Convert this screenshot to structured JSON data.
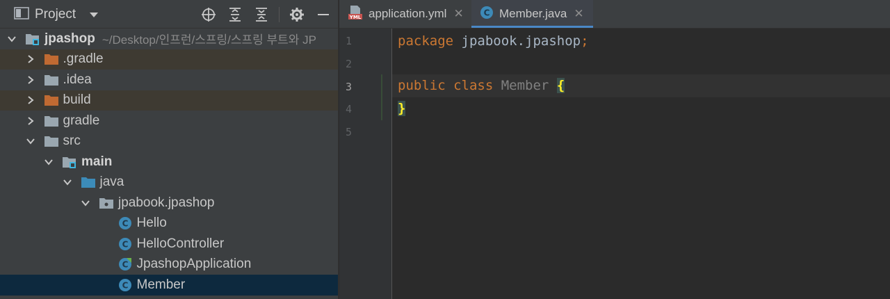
{
  "project_panel": {
    "title": "Project",
    "tree": [
      {
        "label": "jpashop",
        "path": "~/Desktop/인프런/스프링/스프링 부트와 JP",
        "depth": 0,
        "expanded": true,
        "icon": "module-folder-icon",
        "bold": true,
        "row": "normal"
      },
      {
        "label": ".gradle",
        "depth": 1,
        "expanded": false,
        "icon": "excluded-folder-icon",
        "row": "ignored"
      },
      {
        "label": ".idea",
        "depth": 1,
        "expanded": false,
        "icon": "folder-icon",
        "row": "normal"
      },
      {
        "label": "build",
        "depth": 1,
        "expanded": false,
        "icon": "excluded-folder-icon",
        "row": "ignored"
      },
      {
        "label": "gradle",
        "depth": 1,
        "expanded": false,
        "icon": "folder-icon",
        "row": "normal"
      },
      {
        "label": "src",
        "depth": 1,
        "expanded": true,
        "icon": "folder-icon",
        "row": "normal"
      },
      {
        "label": "main",
        "depth": 2,
        "expanded": true,
        "icon": "module-folder-icon",
        "bold": true,
        "row": "normal"
      },
      {
        "label": "java",
        "depth": 3,
        "expanded": true,
        "icon": "source-folder-icon",
        "row": "normal"
      },
      {
        "label": "jpabook.jpashop",
        "depth": 4,
        "expanded": true,
        "icon": "package-icon",
        "row": "normal"
      },
      {
        "label": "Hello",
        "depth": 5,
        "icon": "java-class-icon",
        "row": "normal"
      },
      {
        "label": "HelloController",
        "depth": 5,
        "icon": "java-class-icon",
        "row": "normal"
      },
      {
        "label": "JpashopApplication",
        "depth": 5,
        "icon": "spring-boot-class-icon",
        "row": "normal"
      },
      {
        "label": "Member",
        "depth": 5,
        "icon": "java-class-icon",
        "row": "selected"
      }
    ]
  },
  "editor": {
    "tabs": [
      {
        "label": "application.yml",
        "icon": "yml-file-icon",
        "active": false
      },
      {
        "label": "Member.java",
        "icon": "java-class-icon",
        "active": true
      }
    ],
    "line_numbers": [
      "1",
      "2",
      "3",
      "4",
      "5"
    ],
    "current_line": 3,
    "code": {
      "l1_kw": "package",
      "l1_rest": " jpabook.jpashop",
      "l1_semi": ";",
      "l3_kw": "public class",
      "l3_name": " Member ",
      "l3_brace": "{",
      "l4_brace": "}"
    }
  },
  "colors": {
    "keyword": "#cc7832",
    "plain": "#a9b7c6",
    "brace_match": "#ffef28",
    "selection": "#0d293e",
    "active_tab_underline": "#4a88c7"
  }
}
